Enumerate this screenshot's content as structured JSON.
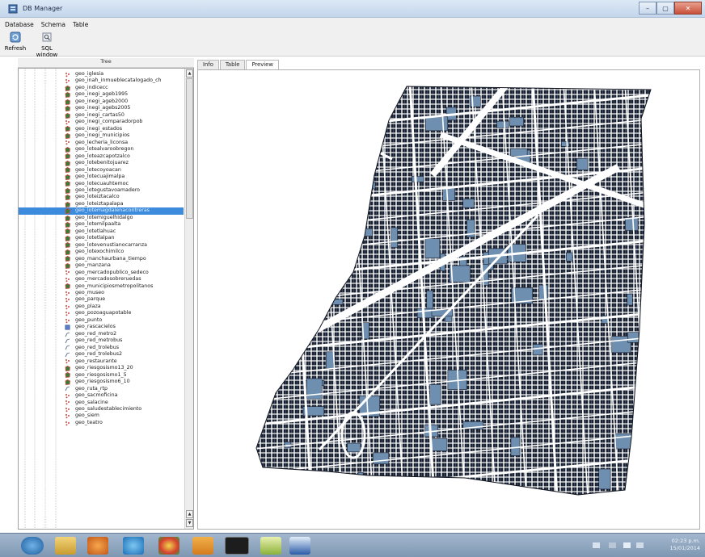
{
  "window": {
    "title": "DB Manager",
    "minimize": "–",
    "maximize": "▢",
    "close": "✕"
  },
  "menu": [
    "Database",
    "Schema",
    "Table"
  ],
  "toolbar": {
    "refresh_label": "Refresh",
    "sql_label": "SQL window"
  },
  "tree": {
    "title": "Tree",
    "selected_index": 20,
    "items": [
      {
        "label": "geo_iglesia",
        "type": "point"
      },
      {
        "label": "geo_inah_inmueblecatalogado_ch",
        "type": "point"
      },
      {
        "label": "geo_indicecc",
        "type": "polygon"
      },
      {
        "label": "geo_inegi_ageb1995",
        "type": "polygon"
      },
      {
        "label": "geo_inegi_ageb2000",
        "type": "polygon"
      },
      {
        "label": "geo_inegi_agebs2005",
        "type": "polygon"
      },
      {
        "label": "geo_inegi_cartas50",
        "type": "polygon"
      },
      {
        "label": "geo_inegi_comparadorpob",
        "type": "point"
      },
      {
        "label": "geo_inegi_estados",
        "type": "polygon"
      },
      {
        "label": "geo_inegi_municipios",
        "type": "polygon"
      },
      {
        "label": "geo_lecheria_liconsa",
        "type": "point"
      },
      {
        "label": "geo_lotealvaroobregon",
        "type": "polygon"
      },
      {
        "label": "geo_loteazcapotzalco",
        "type": "polygon"
      },
      {
        "label": "geo_lotebenitojuarez",
        "type": "polygon"
      },
      {
        "label": "geo_lotecoyoacan",
        "type": "polygon"
      },
      {
        "label": "geo_lotecuajimalpa",
        "type": "polygon"
      },
      {
        "label": "geo_lotecuauhtemoc",
        "type": "polygon"
      },
      {
        "label": "geo_lotegustavoamadero",
        "type": "polygon"
      },
      {
        "label": "geo_loteiztacalco",
        "type": "polygon"
      },
      {
        "label": "geo_loteiztapalapa",
        "type": "polygon"
      },
      {
        "label": "geo_lotemagdalenacontreras",
        "type": "polygon"
      },
      {
        "label": "geo_lotemiguelhidalgo",
        "type": "polygon"
      },
      {
        "label": "geo_lotemilpaalta",
        "type": "polygon"
      },
      {
        "label": "geo_lotetlahuac",
        "type": "polygon"
      },
      {
        "label": "geo_lotetlalpan",
        "type": "polygon"
      },
      {
        "label": "geo_lotevenustianocarranza",
        "type": "polygon"
      },
      {
        "label": "geo_lotexochimilco",
        "type": "polygon"
      },
      {
        "label": "geo_manchaurbana_tiempo",
        "type": "polygon"
      },
      {
        "label": "geo_manzana",
        "type": "polygon"
      },
      {
        "label": "geo_mercadopublico_sedeco",
        "type": "point"
      },
      {
        "label": "geo_mercadosobreruedas",
        "type": "point"
      },
      {
        "label": "geo_municipiosmetropolitanos",
        "type": "polygon"
      },
      {
        "label": "geo_museo",
        "type": "point"
      },
      {
        "label": "geo_parque",
        "type": "point"
      },
      {
        "label": "geo_plaza",
        "type": "point"
      },
      {
        "label": "geo_pozoaguapotable",
        "type": "point"
      },
      {
        "label": "geo_punto",
        "type": "point"
      },
      {
        "label": "geo_rascacielos",
        "type": "table"
      },
      {
        "label": "geo_red_metro2",
        "type": "line"
      },
      {
        "label": "geo_red_metrobus",
        "type": "line"
      },
      {
        "label": "geo_red_trolebus",
        "type": "line"
      },
      {
        "label": "geo_red_trolebus2",
        "type": "line"
      },
      {
        "label": "geo_restaurante",
        "type": "point"
      },
      {
        "label": "geo_riesgosismo13_20",
        "type": "polygon"
      },
      {
        "label": "geo_riesgosismo1_5",
        "type": "polygon"
      },
      {
        "label": "geo_riesgosismo6_10",
        "type": "polygon"
      },
      {
        "label": "geo_ruta_rtp",
        "type": "line"
      },
      {
        "label": "geo_sacmoficina",
        "type": "point"
      },
      {
        "label": "geo_salacine",
        "type": "point"
      },
      {
        "label": "geo_saludestablecimiento",
        "type": "point"
      },
      {
        "label": "geo_siem",
        "type": "point"
      },
      {
        "label": "geo_teatro",
        "type": "point"
      }
    ]
  },
  "tabs": [
    {
      "label": "Info",
      "active": false
    },
    {
      "label": "Table",
      "active": false
    },
    {
      "label": "Preview",
      "active": true
    }
  ],
  "preview": {
    "fill_color": "#6f8fb0",
    "street_color": "#ffffff",
    "block_color": "#1a2130"
  },
  "taskbar": {
    "time": "02:23 p.m.",
    "date": "15/01/2014"
  },
  "colors": {
    "selection": "#3c8bdc",
    "point_icon": "#c84a3a",
    "polygon_icon": "#3d7a3a"
  }
}
